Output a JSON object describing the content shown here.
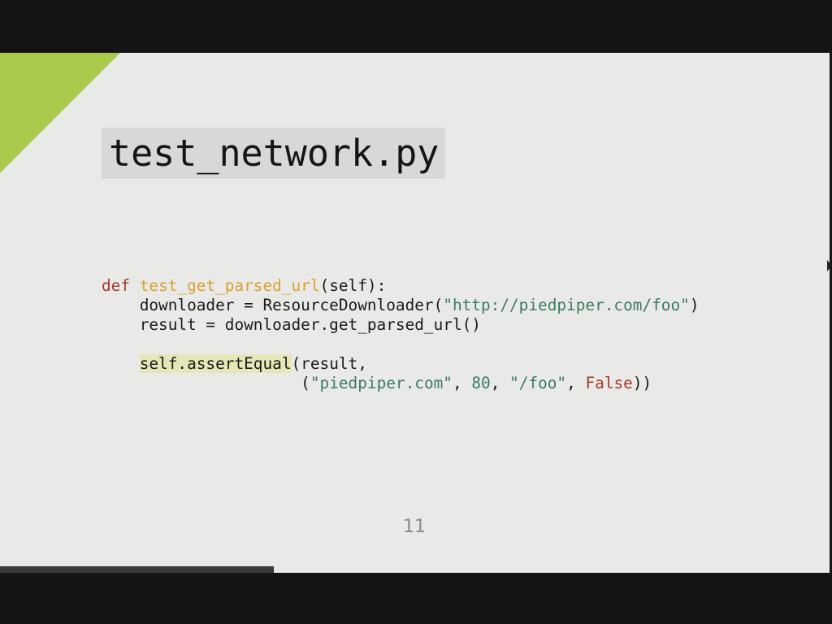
{
  "slide": {
    "title": "test_network.py",
    "page_number": "11",
    "progress_fraction": 0.33
  },
  "code": {
    "line1": {
      "kw_def": "def",
      "sp": " ",
      "fn_name": "test_get_parsed_url",
      "rest": "(self):"
    },
    "line2": {
      "indent": "    ",
      "pre": "downloader = ResourceDownloader(",
      "url": "\"http://piedpiper.com/foo\"",
      "post": ")"
    },
    "line3": {
      "indent": "    ",
      "text": "result = downloader.get_parsed_url()"
    },
    "line5": {
      "indent": "    ",
      "method": "self.assertEqual",
      "rest": "(result,"
    },
    "line6": {
      "indent": "                     ",
      "open": "(",
      "host": "\"piedpiper.com\"",
      "sep1": ", ",
      "port": "80",
      "sep2": ", ",
      "path": "\"/foo\"",
      "sep3": ", ",
      "flag": "False",
      "close": "))"
    }
  },
  "colors": {
    "accent": "#a9c94a",
    "keyword": "#a33a2a",
    "function": "#d9a033",
    "string": "#3a7d5e",
    "highlight": "#e6e6b9"
  }
}
